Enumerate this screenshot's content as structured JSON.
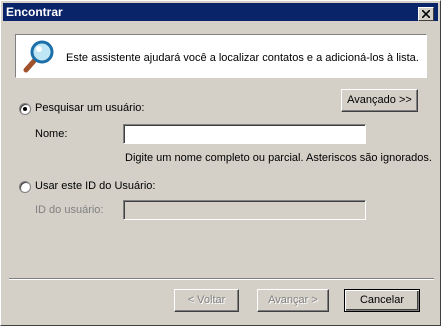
{
  "window": {
    "title": "Encontrar"
  },
  "banner": {
    "text": "Este assistente ajudará você a localizar contatos e a adicioná-los à lista."
  },
  "buttons": {
    "advanced": "Avançado >>",
    "back": "< Voltar",
    "next": "Avançar >",
    "cancel": "Cancelar"
  },
  "search_user": {
    "radio_label": "Pesquisar um usuário:",
    "selected": true,
    "name_label": "Nome:",
    "name_value": "",
    "hint": "Digite um nome completo ou parcial. Asteriscos são ignorados."
  },
  "user_id": {
    "radio_label": "Usar este ID do Usuário:",
    "selected": false,
    "id_label": "ID do usuário:",
    "id_value": ""
  },
  "colors": {
    "titlebar": "#0a246a",
    "face": "#d4d0c8"
  },
  "icons": {
    "banner": "magnifier-icon",
    "close": "close-icon"
  }
}
